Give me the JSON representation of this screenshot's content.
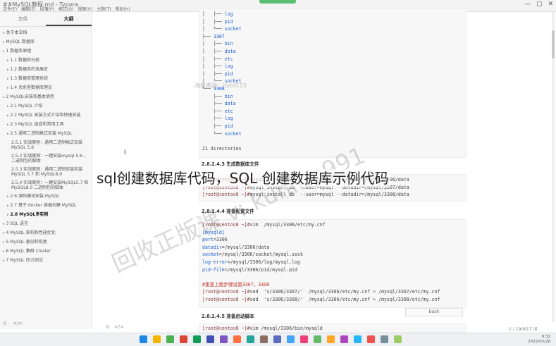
{
  "window": {
    "title": "##MySQL教程.md - Typora",
    "menu": [
      "文件(F)",
      "编辑(E)",
      "段落(P)",
      "格式(O)",
      "视图(V)",
      "主题(T)",
      "帮助(H)"
    ],
    "controls": [
      "—",
      "▢",
      "✕"
    ]
  },
  "sidebar": {
    "tabs": [
      "文件",
      "大纲"
    ],
    "active_tab": "大纲",
    "items": [
      {
        "label": "关于本文档",
        "level": 1
      },
      {
        "label": "MySQL 数据库",
        "level": 1
      },
      {
        "label": "1 数据库原理",
        "level": 1
      },
      {
        "label": "1.1 数据的分类",
        "level": 2
      },
      {
        "label": "1.2 数据库的发展史",
        "level": 2
      },
      {
        "label": "1.3 数据库管理系统",
        "level": 2
      },
      {
        "label": "1.4 关系型数据库理论",
        "level": 2
      },
      {
        "label": "2 MySQL安装和基本使用",
        "level": 1
      },
      {
        "label": "2.1 MySQL 介绍",
        "level": 2
      },
      {
        "label": "2.2 MySQL 安装方式介绍和快速安装",
        "level": 2
      },
      {
        "label": "2.3 MySQL 组成和常用工具",
        "level": 2
      },
      {
        "label": "2.5 通用二进制格式安装 MySQL",
        "level": 2
      },
      {
        "label": "2.5.1 实战案例：通用二进制格式安装 MySQL 5.6",
        "level": 3
      },
      {
        "label": "2.5.2 实战案例：一键安装mysql-5.6...二进制包的脚本",
        "level": 3
      },
      {
        "label": "2.5.3 实战案例：通用二进制安装安装 MySQL 5.7 和 MySQL8.0",
        "level": 3
      },
      {
        "label": "2.5.4 实战案例：一键安装MySQL5.7 和 MySQL8.0 二进制包的脚本",
        "level": 3
      },
      {
        "label": "2.6 源码编译安装 MySQL",
        "level": 2
      },
      {
        "label": "2.7 基于 docker 容器创建 MySQL",
        "level": 2
      },
      {
        "label": "2.8 MySQL多实例",
        "level": 2,
        "active": true
      },
      {
        "label": "3 SQL 语言",
        "level": 1
      },
      {
        "label": "4 MySQL 架构和性能优化",
        "level": 1
      },
      {
        "label": "5 MySQL 备份和恢复",
        "level": 1
      },
      {
        "label": "6 MySQL 集群 Cluster",
        "level": 1
      },
      {
        "label": "7 MySQL 压力测试",
        "level": 1
      }
    ],
    "bottom_icons": [
      "⊙",
      "</>"
    ]
  },
  "document": {
    "tree_block": [
      "│   ├── log",
      "│   ├── pid",
      "│   └── socket",
      "├── 3307",
      "│   ├── bin",
      "│   ├── data",
      "│   ├── etc",
      "│   ├── log",
      "│   ├── pid",
      "│   └── socket",
      "└── 3308",
      "    ├── bin",
      "    ├── data",
      "    ├── etc",
      "    ├── log",
      "    ├── pid",
      "    └── socket",
      "",
      "21 directories"
    ],
    "heading_init": "2.8.2.4.3 生成数据库文件",
    "init_block": [
      "[root@centos8 ~]#mysql_install_db  --user=mysql --datadir=/mysql/3306/data",
      "[root@centos8 ~]#mysql_install_db  --user=mysql --datadir=/mysql/3307/data",
      "[root@centos8 ~]#mysql_install_db  --user=mysql --datadir=/mysql/3308/data"
    ],
    "heading_config": "2.8.2.4.4 准备配置文件",
    "config_block": [
      "[root@centos8 ~]#vim  /mysql/3306/etc/my.cnf",
      "[mysqld]",
      "port=3306",
      "datadir=/mysql/3306/data",
      "socket=/mysql/3306/socket/mysql.sock",
      "log-error=/mysql/3306/log/mysql.log",
      "pid-file=/mysql/3306/pid/mysql.pid",
      "",
      "#重复上面步骤设置3307，3308",
      "[root@centos8 ~]#sed  's/3306/3307/'  /mysql/3306/etc/my.cnf > /mysql/3307/etc/my.cnf",
      "[root@centos8 ~]#sed  's/3306/3308/'  /mysql/3306/etc/my.cnf > /mysql/3308/etc/my.cnf"
    ],
    "bash_label": "bash",
    "heading_start": "2.8.2.4.5 准备启动脚本",
    "start_block": [
      "[root@centos8 ~]#vim /mysql/3306/bin/mysqld"
    ],
    "word_count": "2 / 190617 词"
  },
  "overlays": {
    "page_title": "sql创建数据库代码，SQL 创建数据库示例代码",
    "watermark_main": "回收正版课 v: kunlun991",
    "watermark_small": "海量资源：itxtd123"
  },
  "taskbar": {
    "icon_colors": [
      "#1e88e5",
      "#f4b400",
      "#4caf50",
      "#db4437",
      "#0f9d58",
      "#3f51b5",
      "#7e57c2",
      "#ff7043",
      "#26a69a",
      "#8d6e63",
      "#5c6bc0",
      "#42a5f5",
      "#ec407a",
      "#66bb6a",
      "#ffa726",
      "#ab47bc",
      "#29b6f6",
      "#ef5350",
      "#78909c",
      "#9ccc65"
    ],
    "time": "9:32",
    "date": "2022/05/28"
  }
}
